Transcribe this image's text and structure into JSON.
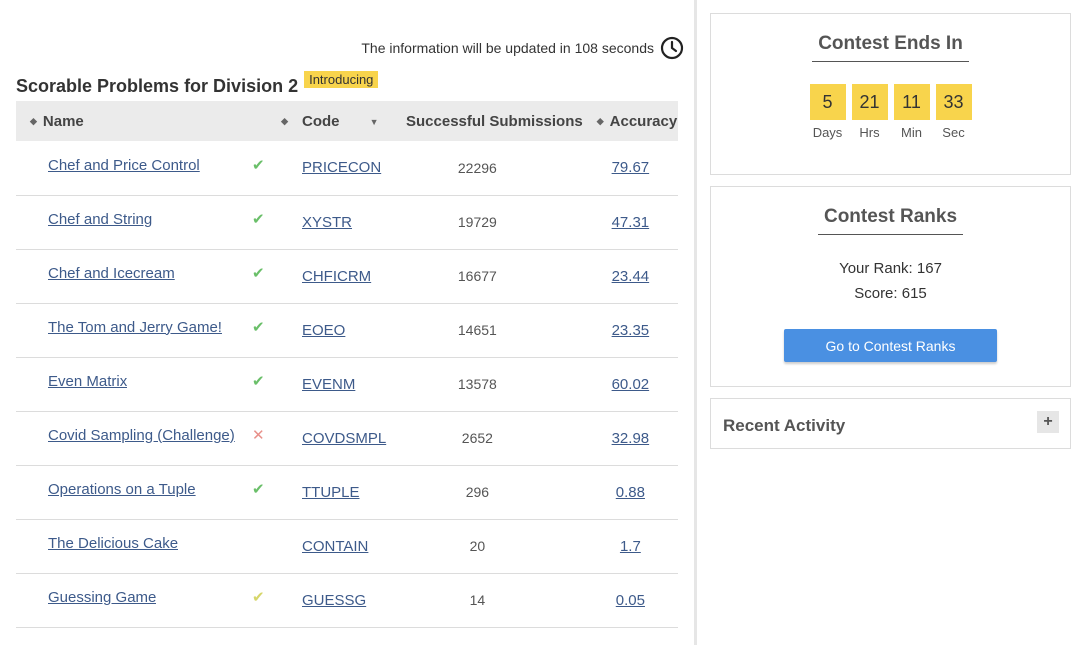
{
  "update_note": "The information will be updated in 108 seconds",
  "section": {
    "title": "Scorable Problems for Division 2",
    "badge": "Introducing"
  },
  "table": {
    "headers": {
      "name": "Name",
      "code": "Code",
      "subs": "Successful Submissions",
      "accuracy": "Accuracy"
    },
    "rows": [
      {
        "name": "Chef and Price Control",
        "status": "solved",
        "status_icon": "✔",
        "code": "PRICECON",
        "subs": "22296",
        "accuracy": "79.67"
      },
      {
        "name": "Chef and String",
        "status": "solved",
        "status_icon": "✔",
        "code": "XYSTR",
        "subs": "19729",
        "accuracy": "47.31"
      },
      {
        "name": "Chef and Icecream",
        "status": "solved",
        "status_icon": "✔",
        "code": "CHFICRM",
        "subs": "16677",
        "accuracy": "23.44"
      },
      {
        "name": "The Tom and Jerry Game!",
        "status": "solved",
        "status_icon": "✔",
        "code": "EOEO",
        "subs": "14651",
        "accuracy": "23.35"
      },
      {
        "name": "Even Matrix",
        "status": "solved",
        "status_icon": "✔",
        "code": "EVENM",
        "subs": "13578",
        "accuracy": "60.02"
      },
      {
        "name": "Covid Sampling (Challenge)",
        "status": "wrong",
        "status_icon": "✕",
        "code": "COVDSMPL",
        "subs": "2652",
        "accuracy": "32.98"
      },
      {
        "name": "Operations on a Tuple",
        "status": "solved",
        "status_icon": "✔",
        "code": "TTUPLE",
        "subs": "296",
        "accuracy": "0.88"
      },
      {
        "name": "The Delicious Cake",
        "status": "none",
        "status_icon": "",
        "code": "CONTAIN",
        "subs": "20",
        "accuracy": "1.7"
      },
      {
        "name": "Guessing Game",
        "status": "partial",
        "status_icon": "✔",
        "code": "GUESSG",
        "subs": "14",
        "accuracy": "0.05"
      }
    ]
  },
  "timer": {
    "title": "Contest Ends In",
    "units": [
      {
        "value": "5",
        "label": "Days"
      },
      {
        "value": "21",
        "label": "Hrs"
      },
      {
        "value": "11",
        "label": "Min"
      },
      {
        "value": "33",
        "label": "Sec"
      }
    ]
  },
  "ranks": {
    "title": "Contest Ranks",
    "your_rank": "Your Rank: 167",
    "score": "Score: 615",
    "button": "Go to Contest Ranks"
  },
  "activity": {
    "title": "Recent Activity",
    "expand": "+"
  },
  "colors": {
    "link": "#3d5a8a",
    "badge": "#f8d44c",
    "button": "#4a90e2",
    "solved": "#6abf69",
    "wrong": "#e8908a",
    "partial": "#d6d66a"
  }
}
